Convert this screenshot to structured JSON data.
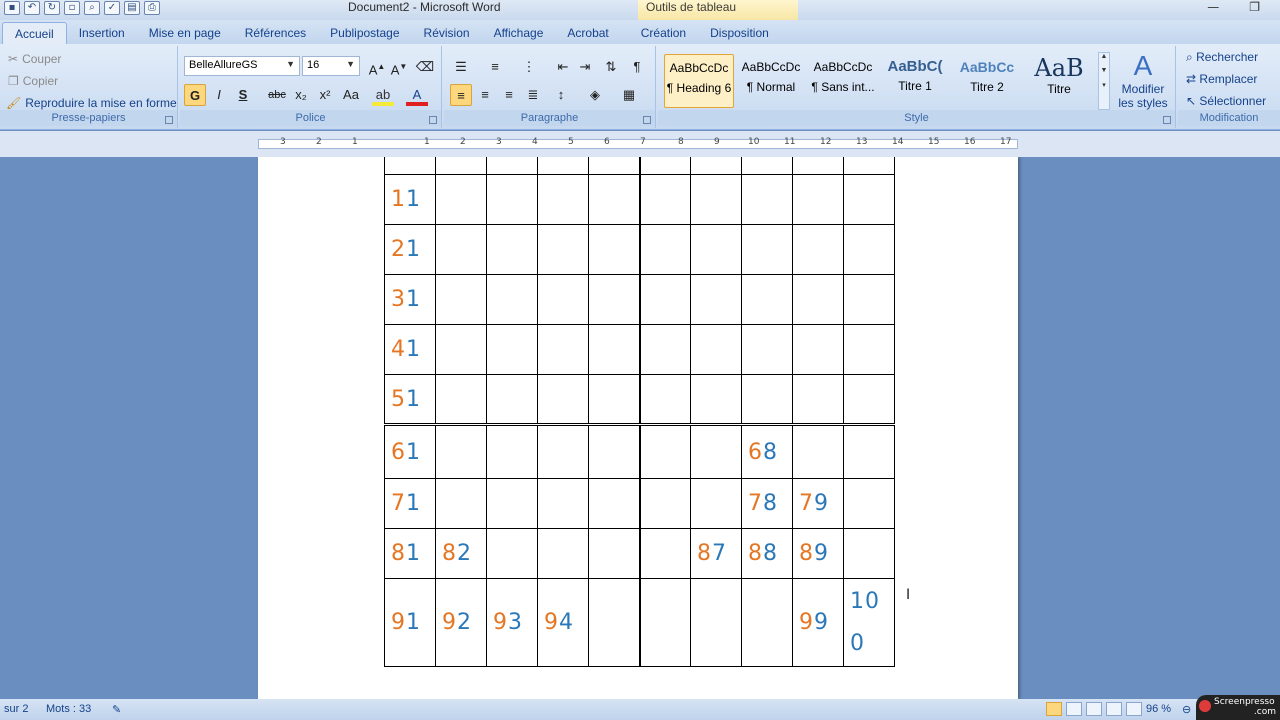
{
  "window": {
    "title": "Document2 - Microsoft Word",
    "context_tab_title": "Outils de tableau"
  },
  "tabs": [
    {
      "label": "Accueil",
      "active": true
    },
    {
      "label": "Insertion"
    },
    {
      "label": "Mise en page"
    },
    {
      "label": "Références"
    },
    {
      "label": "Publipostage"
    },
    {
      "label": "Révision"
    },
    {
      "label": "Affichage"
    },
    {
      "label": "Acrobat"
    },
    {
      "label": "Création"
    },
    {
      "label": "Disposition"
    }
  ],
  "clipboard": {
    "cut": "Couper",
    "copy": "Copier",
    "format_painter": "Reproduire la mise en forme",
    "label": "Presse-papiers"
  },
  "font": {
    "name": "BelleAllureGS",
    "size": "16",
    "label": "Police",
    "bold": "G",
    "italic": "I",
    "underline": "S",
    "strike": "abc",
    "subscript": "x₂",
    "superscript": "x²",
    "case": "Aa"
  },
  "paragraph": {
    "label": "Paragraphe",
    "pilcrow": "¶"
  },
  "styles": {
    "label": "Style",
    "items": [
      {
        "sample": "AaBbCcDc",
        "name": "¶ Heading 6",
        "selected": true
      },
      {
        "sample": "AaBbCcDc",
        "name": "¶ Normal"
      },
      {
        "sample": "AaBbCcDc",
        "name": "¶ Sans int..."
      },
      {
        "sample": "AaBbC(",
        "name": "Titre 1"
      },
      {
        "sample": "AaBbCc",
        "name": "Titre 2"
      },
      {
        "sample": "AaB",
        "name": "Titre"
      }
    ],
    "modify_line1": "Modifier",
    "modify_line2": "les styles"
  },
  "editing": {
    "label": "Modification",
    "find": "Rechercher",
    "replace": "Remplacer",
    "select": "Sélectionner"
  },
  "ruler": {
    "ticks": [
      "3",
      "2",
      "1",
      "1",
      "2",
      "3",
      "4",
      "5",
      "6",
      "7",
      "8",
      "9",
      "10",
      "11",
      "12",
      "13",
      "14",
      "15",
      "16",
      "17"
    ]
  },
  "table": {
    "rows": [
      [
        "",
        "",
        "",
        "",
        "",
        "",
        "",
        "",
        "",
        ""
      ],
      [
        "11",
        "",
        "",
        "",
        "",
        "",
        "",
        "",
        "",
        ""
      ],
      [
        "21",
        "",
        "",
        "",
        "",
        "",
        "",
        "",
        "",
        ""
      ],
      [
        "31",
        "",
        "",
        "",
        "",
        "",
        "",
        "",
        "",
        ""
      ],
      [
        "41",
        "",
        "",
        "",
        "",
        "",
        "",
        "",
        "",
        ""
      ],
      [
        "51",
        "",
        "",
        "",
        "",
        "",
        "",
        "",
        "",
        ""
      ],
      [
        "61",
        "",
        "",
        "",
        "",
        "",
        "",
        "68",
        "",
        ""
      ],
      [
        "71",
        "",
        "",
        "",
        "",
        "",
        "",
        "78",
        "79",
        ""
      ],
      [
        "81",
        "82",
        "",
        "",
        "",
        "",
        "87",
        "88",
        "89",
        ""
      ],
      [
        "91",
        "92",
        "93",
        "94",
        "",
        "",
        "",
        "",
        "99",
        "100"
      ]
    ]
  },
  "statusbar": {
    "page": "sur 2",
    "words": "Mots : 33",
    "zoom": "96 %"
  },
  "watermark": {
    "text": "Screenpresso",
    "sub": ".com"
  }
}
